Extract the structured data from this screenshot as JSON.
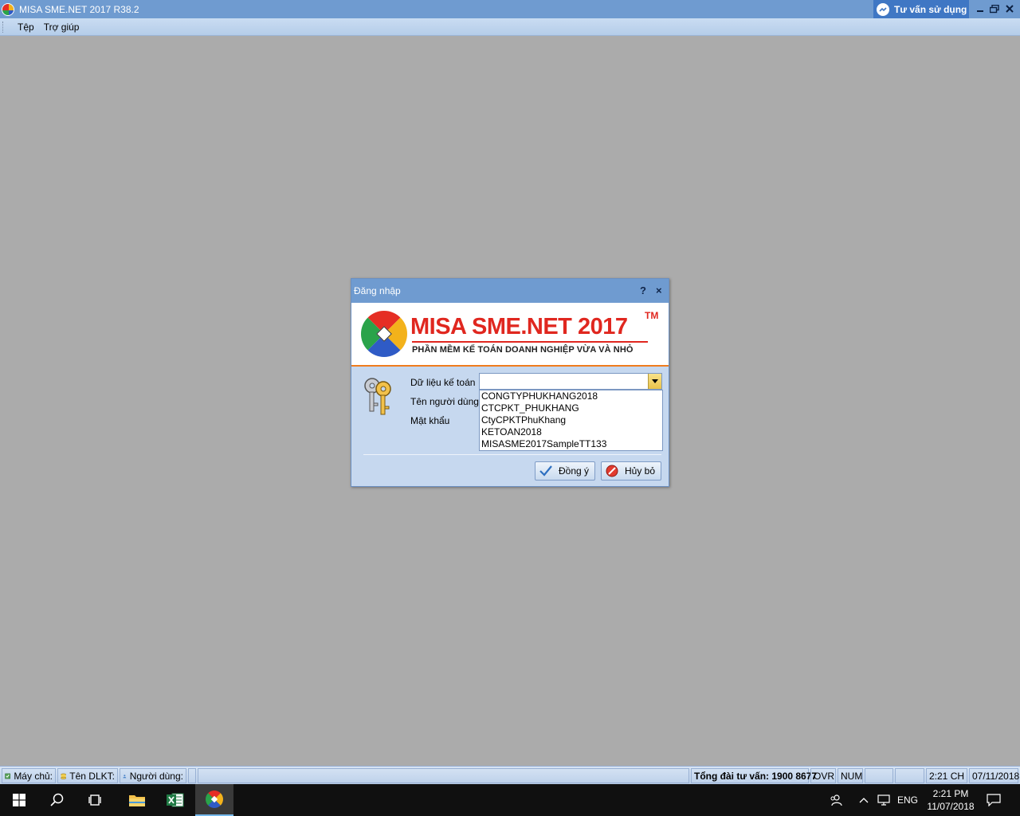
{
  "window": {
    "title": "MISA SME.NET 2017 R38.2",
    "consult_label": "Tư vấn sử dụng"
  },
  "menu": {
    "items": [
      "Tệp",
      "Trợ giúp"
    ]
  },
  "dialog": {
    "title": "Đăng nhập",
    "help_glyph": "?",
    "close_glyph": "×",
    "brand": "MISA SME.NET 2017",
    "brand_tm": "TM",
    "tagline": "PHẦN MỀM KẾ TOÁN DOANH NGHIỆP VỪA VÀ NHỎ",
    "labels": {
      "data": "Dữ liệu kế toán",
      "user": "Tên người dùng",
      "password": "Mật khẩu"
    },
    "data_value": "",
    "dropdown_options": [
      "CONGTYPHUKHANG2018",
      "CTCPKT_PHUKHANG",
      "CtyCPKTPhuKhang",
      "KETOAN2018",
      "MISASME2017SampleTT133"
    ],
    "ok_label": "Đồng ý",
    "cancel_label": "Hủy bỏ"
  },
  "statusbar": {
    "server": "Máy chủ:",
    "db_name": "Tên DLKT:",
    "user": "Người dùng:",
    "hotline": "Tổng đài tư vấn: 1900 8677",
    "ovr": "OVR",
    "num": "NUM",
    "time": "2:21 CH",
    "date": "07/11/2018"
  },
  "taskbar": {
    "lang": "ENG",
    "clock_time": "2:21 PM",
    "clock_date": "11/07/2018"
  },
  "colors": {
    "titlebar": "#6f9bd0",
    "desktop": "#ababab",
    "brand_red": "#e0271f",
    "taskbar": "#101010"
  }
}
